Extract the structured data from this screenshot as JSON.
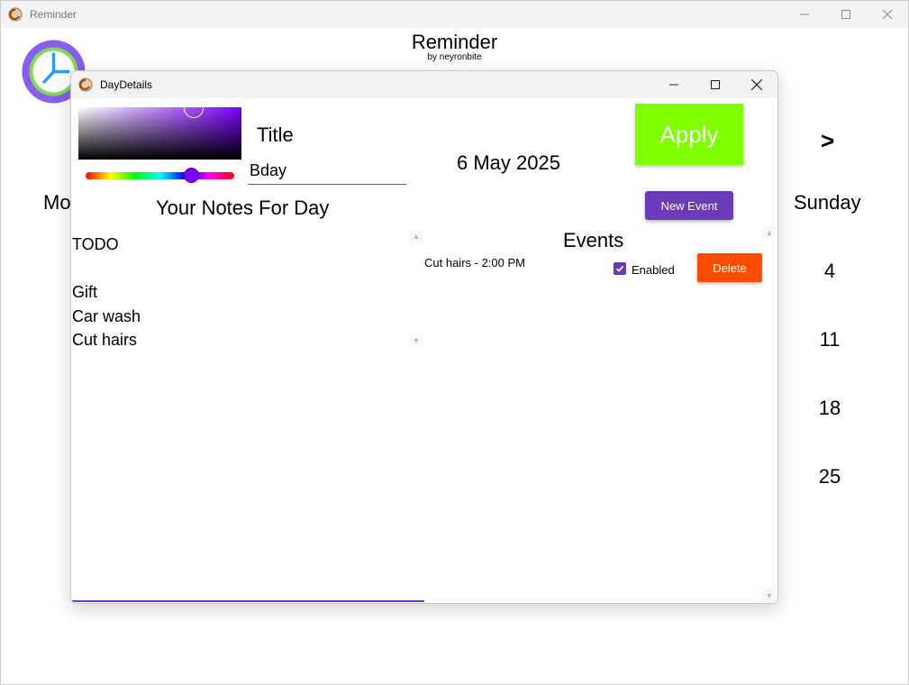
{
  "main_window": {
    "title": "Reminder",
    "header_title": "Reminder",
    "header_subtitle": "by neyronbite",
    "next_label": ">",
    "day_left": "Mo",
    "day_right": "Sunday",
    "dates": [
      "4",
      "11",
      "18",
      "25"
    ]
  },
  "dialog": {
    "title": "DayDetails",
    "title_label": "Title",
    "title_value": "Bday",
    "date": "6 May 2025",
    "apply_label": "Apply",
    "new_event_label": "New Event",
    "notes_heading": "Your Notes For Day",
    "notes_text": "TODO\n\nGift\nCar wash\nCut hairs",
    "events_heading": "Events",
    "events": [
      {
        "text": "Cut hairs - 2:00 PM",
        "enabled_label": "Enabled",
        "enabled": true,
        "delete_label": "Delete"
      }
    ]
  },
  "colors": {
    "apply": "#7fff00",
    "new_event": "#6a3ab8",
    "delete": "#ff4d00",
    "picker_hue": "#7a00ff",
    "logo_ring": "#8a5cf0",
    "logo_inner": "#7ed957"
  },
  "icons": [
    "app-icon",
    "clock-icon",
    "minimize-icon",
    "maximize-icon",
    "close-icon",
    "check-icon",
    "scroll-up-icon",
    "scroll-down-icon"
  ]
}
